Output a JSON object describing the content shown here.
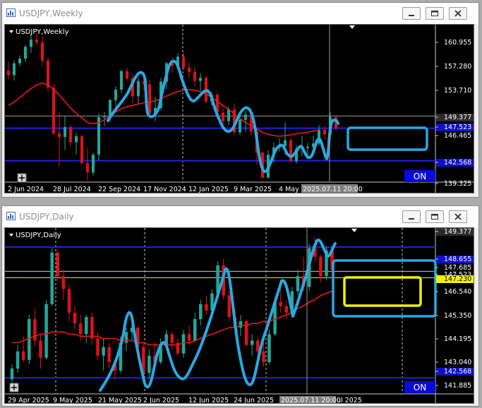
{
  "colors": {
    "bull": "#26a69a",
    "bear": "#e0101a",
    "ma": "#e41b17",
    "blue_line": "#1010c8",
    "highlight": "#2aa8e0",
    "box_yellow": "#f2f200",
    "on_button": "#0a0ad8",
    "background": "#000000"
  },
  "weekly": {
    "title": "USDJPY,Weekly",
    "symbol_label": "USDJPY,Weekly",
    "prices": [
      "160.955",
      "157.280",
      "153.710",
      "149.377",
      "147.523",
      "146.465",
      "142.568",
      "139.325"
    ],
    "dates": [
      "2 Jun 2024",
      "28 Jul 2024",
      "22 Sep 2024",
      "17 Nov 2024",
      "12 Jan 2025",
      "9 Mar 2025",
      "4 May 2025"
    ],
    "cursor_time": "2025.07.11 20:00",
    "on_label": "ON",
    "plus_icon": "plus-icon",
    "chart_data": {
      "type": "candlestick",
      "symbol": "USDJPY",
      "timeframe": "Weekly",
      "ylim": [
        139.325,
        162.3
      ],
      "horizontal_levels": [
        149.377,
        147.523,
        142.568
      ],
      "ohlc": [
        [
          156.3,
          157.6,
          155.0,
          155.6
        ],
        [
          155.6,
          157.8,
          154.8,
          157.4
        ],
        [
          157.4,
          158.6,
          156.9,
          158.1
        ],
        [
          158.1,
          160.2,
          157.6,
          159.9
        ],
        [
          159.9,
          161.9,
          159.0,
          161.0
        ],
        [
          161.0,
          162.0,
          160.1,
          160.6
        ],
        [
          160.6,
          161.5,
          157.0,
          157.8
        ],
        [
          157.8,
          158.3,
          153.0,
          153.7
        ],
        [
          153.7,
          154.3,
          146.5,
          146.7
        ],
        [
          146.7,
          150.0,
          141.7,
          146.2
        ],
        [
          146.2,
          149.4,
          144.2,
          147.7
        ],
        [
          147.7,
          148.0,
          144.7,
          145.4
        ],
        [
          145.4,
          146.8,
          143.5,
          146.3
        ],
        [
          146.3,
          146.5,
          142.0,
          142.2
        ],
        [
          142.2,
          144.5,
          139.6,
          140.8
        ],
        [
          140.8,
          143.8,
          140.3,
          143.5
        ],
        [
          143.5,
          149.8,
          142.6,
          149.2
        ],
        [
          149.2,
          150.0,
          147.8,
          149.4
        ],
        [
          149.4,
          152.0,
          148.6,
          151.8
        ],
        [
          151.8,
          153.9,
          150.8,
          153.4
        ],
        [
          153.4,
          156.5,
          152.8,
          156.2
        ],
        [
          156.2,
          156.7,
          154.7,
          155.1
        ],
        [
          155.1,
          155.8,
          151.3,
          152.4
        ],
        [
          152.4,
          155.3,
          151.2,
          154.7
        ],
        [
          154.7,
          156.0,
          153.2,
          154.2
        ],
        [
          154.2,
          154.9,
          149.2,
          149.8
        ],
        [
          149.8,
          152.3,
          148.6,
          150.6
        ],
        [
          150.6,
          155.2,
          150.2,
          154.6
        ],
        [
          154.6,
          157.6,
          153.5,
          157.4
        ],
        [
          157.4,
          158.4,
          156.0,
          157.0
        ],
        [
          157.0,
          158.9,
          156.4,
          158.4
        ],
        [
          158.4,
          159.0,
          156.3,
          156.7
        ],
        [
          156.7,
          157.5,
          155.2,
          156.1
        ],
        [
          156.1,
          156.9,
          153.8,
          154.7
        ],
        [
          154.7,
          155.9,
          153.2,
          155.2
        ],
        [
          155.2,
          155.6,
          151.3,
          151.6
        ],
        [
          151.6,
          153.1,
          151.0,
          152.6
        ],
        [
          152.6,
          153.0,
          149.5,
          149.9
        ],
        [
          149.9,
          151.0,
          148.0,
          148.6
        ],
        [
          148.6,
          150.8,
          148.0,
          150.4
        ],
        [
          150.4,
          151.2,
          146.4,
          146.9
        ],
        [
          146.9,
          149.3,
          146.5,
          148.8
        ],
        [
          148.8,
          150.1,
          147.0,
          149.6
        ],
        [
          149.6,
          150.5,
          146.5,
          147.0
        ],
        [
          147.0,
          147.5,
          142.0,
          143.8
        ],
        [
          143.8,
          144.0,
          139.9,
          140.0
        ],
        [
          140.0,
          144.2,
          139.9,
          143.5
        ],
        [
          143.5,
          145.3,
          142.3,
          144.6
        ],
        [
          144.6,
          146.0,
          144.0,
          144.8
        ],
        [
          144.8,
          148.4,
          143.4,
          145.7
        ],
        [
          145.7,
          146.0,
          142.3,
          142.5
        ],
        [
          142.5,
          145.0,
          142.1,
          144.4
        ],
        [
          144.4,
          146.3,
          143.3,
          144.5
        ],
        [
          144.5,
          145.3,
          142.8,
          144.7
        ],
        [
          144.7,
          146.4,
          144.0,
          145.2
        ],
        [
          145.2,
          148.0,
          144.9,
          147.3
        ],
        [
          147.3,
          147.8,
          145.8,
          146.6
        ],
        [
          146.6,
          149.9,
          146.3,
          149.2
        ],
        [
          149.2,
          149.6,
          147.2,
          147.5
        ]
      ],
      "moving_average": [
        151.0,
        151.5,
        152.2,
        152.9,
        153.6,
        154.1,
        154.4,
        154.1,
        153.5,
        152.6,
        151.6,
        150.6,
        149.8,
        149.1,
        148.4,
        148.2,
        148.4,
        148.8,
        149.4,
        150.0,
        150.5,
        150.8,
        151.0,
        151.2,
        151.4,
        151.5,
        151.7,
        152.0,
        152.4,
        152.8,
        153.1,
        153.3,
        153.4,
        153.3,
        153.1,
        152.7,
        152.2,
        151.6,
        151.0,
        150.4,
        149.7,
        149.0,
        148.4,
        147.9,
        147.4,
        146.9,
        146.6,
        146.4,
        146.3,
        146.4,
        146.5,
        146.7,
        146.8,
        146.9,
        147.1,
        147.2
      ]
    }
  },
  "daily": {
    "title": "USDJPY,Daily",
    "symbol_label": "USDJPY,Daily",
    "prices": [
      "149.377",
      "148.655",
      "147.685",
      "147.523",
      "147.230",
      "146.540",
      "145.350",
      "144.195",
      "143.040",
      "142.568",
      "141.885"
    ],
    "dates": [
      "29 Apr 2025",
      "9 May 2025",
      "21 May 2025",
      "2 Jun 2025",
      "12 Jun 2025",
      "24 Jun 2025",
      "ul 2025"
    ],
    "cursor_time": "2025.07.11 20:00",
    "on_label": "ON",
    "plus_icon": "plus-icon",
    "chart_data": {
      "type": "candlestick",
      "symbol": "USDJPY",
      "timeframe": "Daily",
      "ylim": [
        141.885,
        149.377
      ],
      "horizontal_levels": [
        148.655,
        147.523,
        147.23,
        142.568
      ],
      "ohlc": [
        [
          142.5,
          143.2,
          142.3,
          143.0
        ],
        [
          143.0,
          144.1,
          142.8,
          143.8
        ],
        [
          143.8,
          144.5,
          143.3,
          143.4
        ],
        [
          143.4,
          145.5,
          143.2,
          145.3
        ],
        [
          145.3,
          145.8,
          144.0,
          144.3
        ],
        [
          144.3,
          144.6,
          143.0,
          143.5
        ],
        [
          143.5,
          146.2,
          143.4,
          146.0
        ],
        [
          146.0,
          148.6,
          145.9,
          148.4
        ],
        [
          148.4,
          148.5,
          147.0,
          147.3
        ],
        [
          147.3,
          147.6,
          146.2,
          146.7
        ],
        [
          146.7,
          146.9,
          145.2,
          145.6
        ],
        [
          145.6,
          145.9,
          144.8,
          145.1
        ],
        [
          145.1,
          145.5,
          144.3,
          144.6
        ],
        [
          144.6,
          145.5,
          144.2,
          145.4
        ],
        [
          145.4,
          145.6,
          144.1,
          144.4
        ],
        [
          144.4,
          144.7,
          143.4,
          143.6
        ],
        [
          143.6,
          144.4,
          142.9,
          144.0
        ],
        [
          144.0,
          144.2,
          143.0,
          143.3
        ],
        [
          143.3,
          143.4,
          142.5,
          142.9
        ],
        [
          142.9,
          144.5,
          142.8,
          144.2
        ],
        [
          144.2,
          144.9,
          143.8,
          144.7
        ],
        [
          144.7,
          145.3,
          144.3,
          144.9
        ],
        [
          144.9,
          145.0,
          143.8,
          144.0
        ],
        [
          144.0,
          144.2,
          142.6,
          142.8
        ],
        [
          142.8,
          143.9,
          142.5,
          143.6
        ],
        [
          143.6,
          144.2,
          143.0,
          143.3
        ],
        [
          143.3,
          144.4,
          143.2,
          144.1
        ],
        [
          144.1,
          144.8,
          143.9,
          144.6
        ],
        [
          144.6,
          144.7,
          143.9,
          144.2
        ],
        [
          144.2,
          144.4,
          143.6,
          143.7
        ],
        [
          143.7,
          144.8,
          143.5,
          144.6
        ],
        [
          144.6,
          145.0,
          144.1,
          144.3
        ],
        [
          144.3,
          145.6,
          144.2,
          145.3
        ],
        [
          145.3,
          146.2,
          145.0,
          146.0
        ],
        [
          146.0,
          146.4,
          145.5,
          145.7
        ],
        [
          145.7,
          146.7,
          145.6,
          146.5
        ],
        [
          146.5,
          148.0,
          146.3,
          147.8
        ],
        [
          147.8,
          148.1,
          146.2,
          146.4
        ],
        [
          146.4,
          146.6,
          145.2,
          145.4
        ],
        [
          145.4,
          145.7,
          144.6,
          144.9
        ],
        [
          144.9,
          145.5,
          144.5,
          145.2
        ],
        [
          145.2,
          145.3,
          144.0,
          144.1
        ],
        [
          144.1,
          144.6,
          143.6,
          144.3
        ],
        [
          144.3,
          144.5,
          143.5,
          143.8
        ],
        [
          143.8,
          144.2,
          143.1,
          143.3
        ],
        [
          143.3,
          144.8,
          143.2,
          144.6
        ],
        [
          144.6,
          146.3,
          144.5,
          146.1
        ],
        [
          146.1,
          147.0,
          145.6,
          145.9
        ],
        [
          145.9,
          146.2,
          145.3,
          145.6
        ],
        [
          145.6,
          146.8,
          145.4,
          146.6
        ],
        [
          146.6,
          147.6,
          146.4,
          147.3
        ],
        [
          147.3,
          148.2,
          146.6,
          146.8
        ],
        [
          146.8,
          148.8,
          146.6,
          148.6
        ],
        [
          148.6,
          149.1,
          147.9,
          148.2
        ],
        [
          148.2,
          148.3,
          147.0,
          147.3
        ],
        [
          147.3,
          148.7,
          147.1,
          148.5
        ],
        [
          148.5,
          148.7,
          147.4,
          147.6
        ]
      ],
      "moving_average": [
        144.2,
        144.2,
        144.3,
        144.4,
        144.5,
        144.6,
        144.6,
        144.7,
        144.7,
        144.7,
        144.6,
        144.6,
        144.5,
        144.5,
        144.5,
        144.5,
        144.4,
        144.4,
        144.4,
        144.3,
        144.3,
        144.3,
        144.2,
        144.2,
        144.1,
        144.1,
        144.1,
        144.1,
        144.1,
        144.1,
        144.2,
        144.2,
        144.3,
        144.4,
        144.5,
        144.6,
        144.7,
        144.8,
        144.9,
        144.9,
        145.0,
        145.0,
        145.1,
        145.1,
        145.2,
        145.2,
        145.3,
        145.4,
        145.5,
        145.6,
        145.8,
        145.9,
        146.1,
        146.2,
        146.4,
        146.5,
        146.6
      ]
    }
  }
}
